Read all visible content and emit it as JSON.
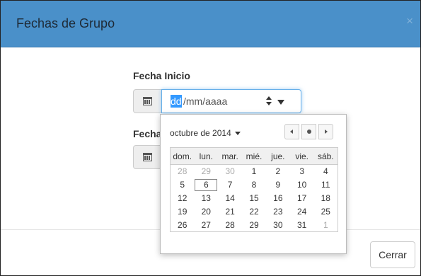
{
  "modal": {
    "title": "Fechas de Grupo",
    "close_label": "×",
    "footer": {
      "close_button": "Cerrar"
    }
  },
  "form": {
    "start_label": "Fecha Inicio",
    "end_label": "Fecha",
    "start_input": {
      "day_segment": "dd",
      "rest": "/mm/aaaa"
    }
  },
  "datepicker": {
    "month_label": "octubre de 2014",
    "weekdays": [
      "dom.",
      "lun.",
      "mar.",
      "mié.",
      "jue.",
      "vie.",
      "sáb."
    ],
    "weeks": [
      [
        "28",
        "29",
        "30",
        "1",
        "2",
        "3",
        "4"
      ],
      [
        "5",
        "6",
        "7",
        "8",
        "9",
        "10",
        "11"
      ],
      [
        "12",
        "13",
        "14",
        "15",
        "16",
        "17",
        "18"
      ],
      [
        "19",
        "20",
        "21",
        "22",
        "23",
        "24",
        "25"
      ],
      [
        "26",
        "27",
        "28",
        "29",
        "30",
        "31",
        "1"
      ]
    ],
    "other_month_cells": [
      [
        0,
        0
      ],
      [
        0,
        1
      ],
      [
        0,
        2
      ],
      [
        4,
        6
      ]
    ],
    "today_cell": [
      1,
      1
    ]
  },
  "colors": {
    "header_bg": "#4a90c9",
    "focus": "#66afe9",
    "selection": "#3399ff"
  },
  "icons": {
    "calendar": "calendar-icon",
    "close": "close-icon"
  }
}
